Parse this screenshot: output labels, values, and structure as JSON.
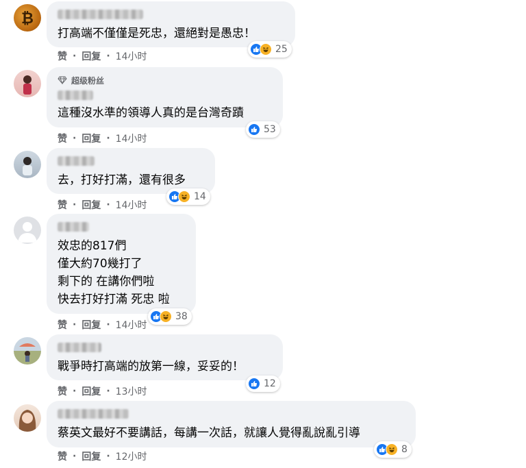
{
  "ui": {
    "like_label": "赞",
    "reply_label": "回复",
    "separator": "·"
  },
  "comments": [
    {
      "text_lines": [
        "打高端不僅僅是死忠，還絕對是愚忠！"
      ],
      "reactions": [
        "like",
        "haha"
      ],
      "reaction_count": "25",
      "time": "14小时"
    },
    {
      "badge": "超级粉丝",
      "text_lines": [
        "這種沒水準的領導人真的是台灣奇蹟"
      ],
      "reactions": [
        "like"
      ],
      "reaction_count": "53",
      "time": "14小时"
    },
    {
      "text_lines": [
        "去，打好打滿，還有很多"
      ],
      "reactions": [
        "like",
        "haha"
      ],
      "reaction_count": "14",
      "time": "14小时"
    },
    {
      "text_lines": [
        "效忠的817們",
        "僅大約70幾打了",
        "剩下的 在講你們啦",
        "快去打好打滿 死忠 啦"
      ],
      "reactions": [
        "like",
        "haha"
      ],
      "reaction_count": "38",
      "time": "14小时"
    },
    {
      "text_lines": [
        "戰爭時打高端的放第一線，妥妥的！"
      ],
      "reactions": [
        "like"
      ],
      "reaction_count": "12",
      "time": "13小时"
    },
    {
      "text_lines": [
        "蔡英文最好不要講話，每講一次話，就讓人覺得亂說亂引導"
      ],
      "reactions": [
        "like",
        "haha"
      ],
      "reaction_count": "8",
      "time": "12小时"
    }
  ],
  "colors": {
    "like": "#1877f2",
    "haha": "#f7b125",
    "bubble": "#f0f2f5",
    "meta_text": "#65676b"
  }
}
